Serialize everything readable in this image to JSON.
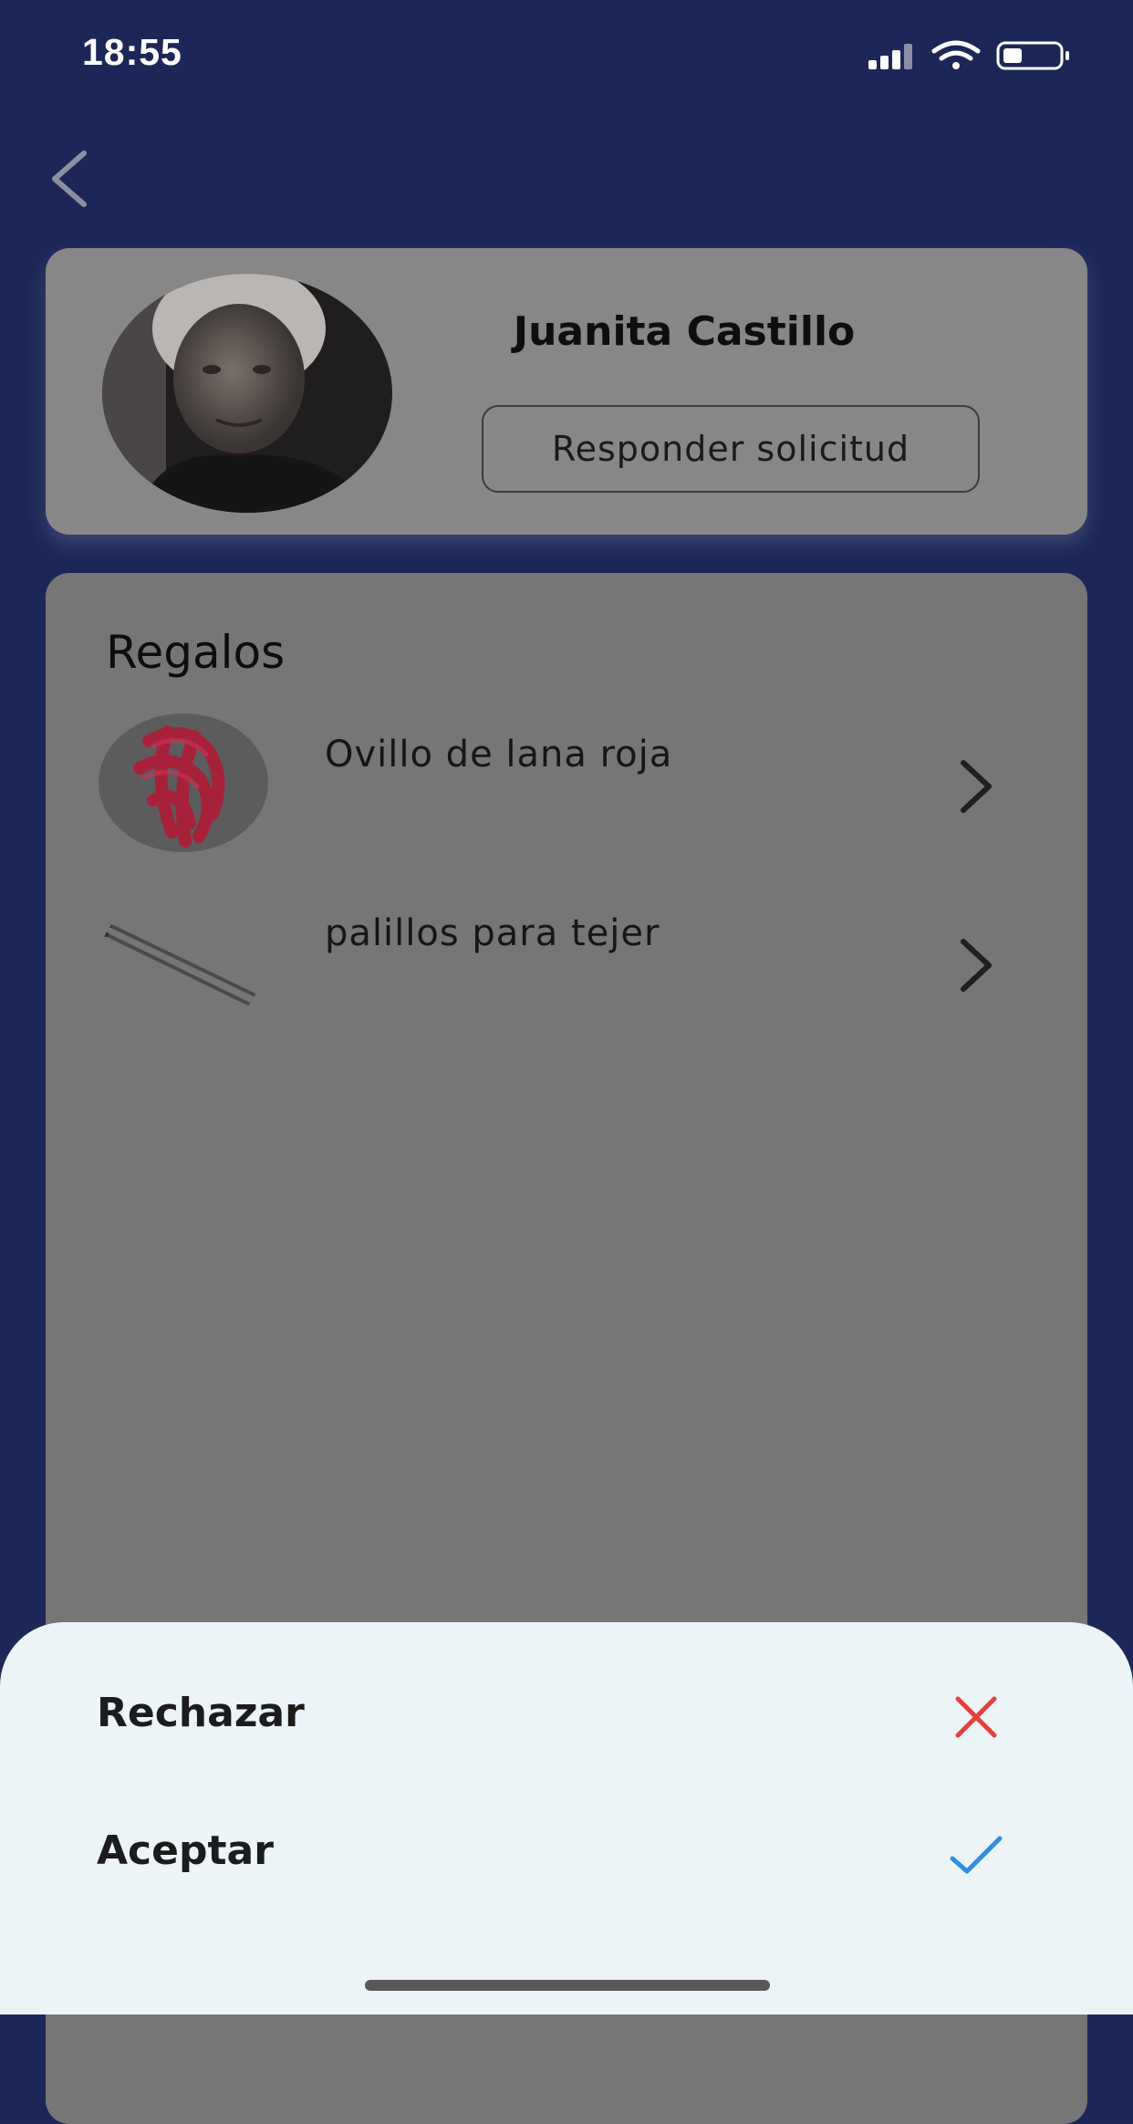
{
  "status_bar": {
    "time": "18:55",
    "icons": [
      "cellular-signal-icon",
      "wifi-icon",
      "battery-icon"
    ]
  },
  "nav": {
    "back_icon": "chevron-left-icon"
  },
  "profile": {
    "name": "Juanita Castillo",
    "action_label": "Responder solicitud"
  },
  "gifts": {
    "title": "Regalos",
    "items": [
      {
        "label": "Ovillo de lana roja",
        "icon": "yarn-ball-thumbnail"
      },
      {
        "label": "palillos para tejer",
        "icon": "knitting-needles-thumbnail"
      }
    ]
  },
  "action_sheet": {
    "options": [
      {
        "label": "Rechazar",
        "icon": "close-icon",
        "color": "#e5413a"
      },
      {
        "label": "Aceptar",
        "icon": "check-icon",
        "color": "#2f8ee0"
      }
    ]
  },
  "colors": {
    "background": "#1d2757",
    "overlay_card": "#878787",
    "sheet_background": "#edf4f7"
  }
}
